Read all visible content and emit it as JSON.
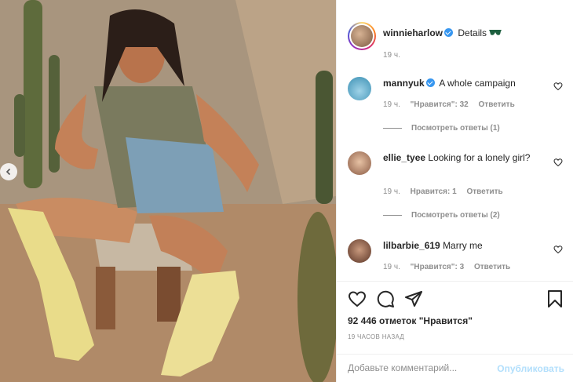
{
  "post": {
    "author": "winnieharlow",
    "caption": "Details",
    "caption_emoji": "sunglasses-emoji",
    "caption_time": "19 ч.",
    "verified": true
  },
  "comments": [
    {
      "user": "mannyuk",
      "verified": true,
      "text": "A whole campaign",
      "time": "19 ч.",
      "likes": "\"Нравится\": 32",
      "reply": "Ответить",
      "view_replies": "Посмотреть ответы (1)"
    },
    {
      "user": "ellie_tyee",
      "verified": false,
      "text": "Looking for a lonely girl?",
      "time": "19 ч.",
      "likes": "Нравится: 1",
      "reply": "Ответить",
      "view_replies": "Посмотреть ответы (2)"
    },
    {
      "user": "lilbarbie_619",
      "verified": false,
      "text": "Marry me",
      "time": "19 ч.",
      "likes": "\"Нравится\": 3",
      "reply": "Ответить"
    }
  ],
  "actions": {
    "like_icon": "heart-icon",
    "comment_icon": "comment-icon",
    "share_icon": "share-icon",
    "save_icon": "bookmark-icon"
  },
  "likes_count": "92 446 отметок \"Нравится\"",
  "time_ago": "19 ЧАСОВ НАЗАД",
  "comment_form": {
    "placeholder": "Добавьте комментарий...",
    "submit": "Опубликовать"
  },
  "colors": {
    "accent": "#3897f0",
    "publish_disabled": "#b2dffc",
    "secondary_text": "#8e8e8e"
  }
}
